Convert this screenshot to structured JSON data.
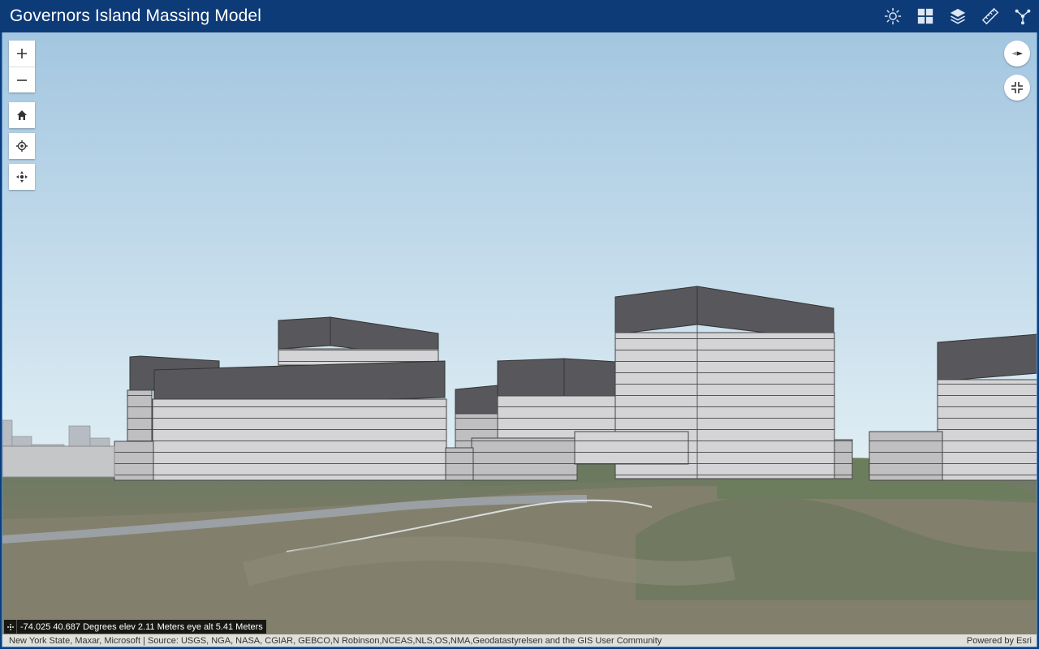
{
  "app": {
    "title": "Governors Island Massing Model"
  },
  "header_tools": [
    {
      "icon": "sun-icon"
    },
    {
      "icon": "basemap-gallery-icon"
    },
    {
      "icon": "layers-icon"
    },
    {
      "icon": "measure-icon"
    },
    {
      "icon": "share-icon"
    }
  ],
  "coordinates": {
    "text": "-74.025 40.687 Degrees   elev 2.11 Meters   eye alt 5.41 Meters"
  },
  "attribution": {
    "sources": "New York State, Maxar, Microsoft | Source: USGS, NGA, NASA, CGIAR, GEBCO,N Robinson,NCEAS,NLS,OS,NMA,Geodatastyrelsen and the GIS User Community",
    "powered_by": "Powered by Esri"
  },
  "colors": {
    "header": "#0d3b78",
    "roof": "#5a5a5e",
    "facade": "#cfcfd1",
    "sky_top": "#a3c6e0",
    "sky_bottom": "#dfeef5"
  }
}
